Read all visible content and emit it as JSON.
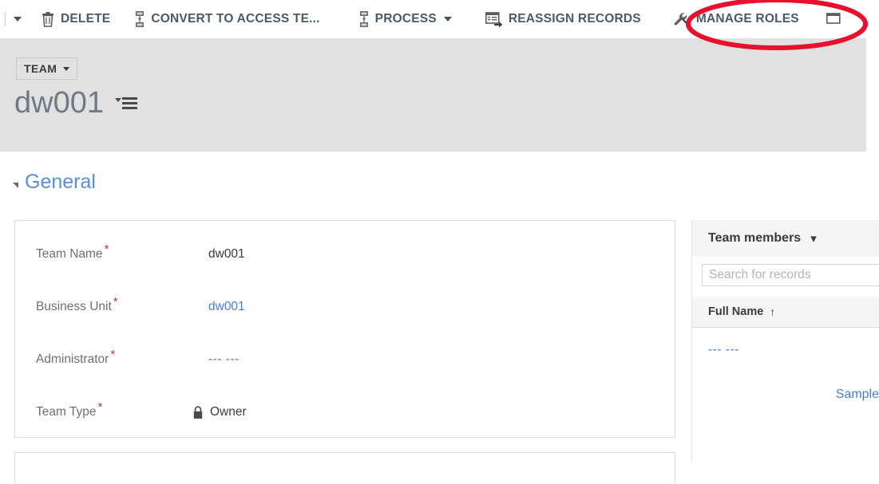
{
  "command_bar": {
    "buttons": [
      {
        "label": "DELETE",
        "icon": "trash-icon",
        "has_caret": false
      },
      {
        "label": "CONVERT TO ACCESS TE...",
        "icon": "convert-team-icon",
        "has_caret": false
      },
      {
        "label": "PROCESS",
        "icon": "process-icon",
        "has_caret": true
      },
      {
        "label": "REASSIGN RECORDS",
        "icon": "reassign-records-icon",
        "has_caret": false
      },
      {
        "label": "MANAGE ROLES",
        "icon": "wrench-icon",
        "has_caret": false
      }
    ],
    "overflow_caret": "chevron-down-icon"
  },
  "record_header": {
    "entity_chip": "TEAM",
    "entity_chip_caret": "caret-down-icon",
    "title": "dw001",
    "title_menu_icon": "record-set-menu-icon"
  },
  "section": {
    "collapse_icon": "collapse-triangle-icon",
    "title": "General"
  },
  "form": {
    "fields": [
      {
        "label": "Team Name",
        "required": "*",
        "value": "dw001",
        "style": "text"
      },
      {
        "label": "Business Unit",
        "required": "*",
        "value": "dw001",
        "style": "link"
      },
      {
        "label": "Administrator",
        "required": "*",
        "value": "--- ---",
        "style": "dashes"
      },
      {
        "label": "Team Type",
        "required": "*",
        "value": "Owner",
        "style": "locked",
        "icon": "lock-icon"
      }
    ]
  },
  "subgrid": {
    "title": "Team members",
    "chevron_icon": "chevron-down-icon",
    "search_placeholder": "Search for records",
    "search_value": "",
    "columns": [
      {
        "label": "Full Name",
        "sort_icon": "sort-ascending-icon",
        "sort_glyph": "↑"
      }
    ],
    "rows": [
      {
        "full_name": "--- ---",
        "secondary": "Sample"
      }
    ]
  },
  "annotation": {
    "type": "ellipse-highlight",
    "target": "MANAGE ROLES",
    "color": "#e8112d"
  }
}
